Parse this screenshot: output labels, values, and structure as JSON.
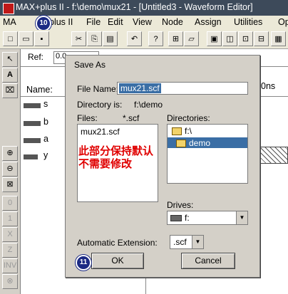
{
  "window": {
    "title": "MAX+plus II - f:\\demo\\mux21 - [Untitled3 - Waveform Editor]"
  },
  "menu": {
    "items": [
      "MA",
      "plus II",
      "File",
      "Edit",
      "View",
      "Node",
      "Assign",
      "Utilities",
      "Options"
    ],
    "badge_10": "10"
  },
  "toolbar": {
    "buttons": [
      "new-icon",
      "open-icon",
      "save-icon",
      "cut-icon",
      "copy-icon",
      "paste-icon",
      "undo-icon",
      "help-icon",
      "hierarchy-icon",
      "compile-icon"
    ]
  },
  "waveform": {
    "ref_label": "Ref:",
    "ref_value": "0.0",
    "name_header": "Name:",
    "time_tick": "0ns",
    "signals": [
      "s",
      "b",
      "a",
      "y"
    ]
  },
  "dialog": {
    "title": "Save As",
    "file_name_label": "File Name:",
    "file_name_value": "mux21.scf",
    "directory_label": "Directory is:",
    "directory_value": "f:\\demo",
    "files_label": "Files:",
    "files_filter": "*.scf",
    "files": [
      "mux21.scf"
    ],
    "directories_label": "Directories:",
    "directories": [
      "f:\\",
      "demo"
    ],
    "drives_label": "Drives:",
    "drive_value": "f:",
    "auto_ext_label": "Automatic Extension:",
    "auto_ext_value": ".scf",
    "ok_label": "OK",
    "cancel_label": "Cancel",
    "badge_11": "11",
    "annotation_line1": "此部分保持默认",
    "annotation_line2": "不需要修改"
  },
  "colors": {
    "selection": "#3a6ea5",
    "annotation": "#e00000",
    "badge": "#1b2a84"
  }
}
